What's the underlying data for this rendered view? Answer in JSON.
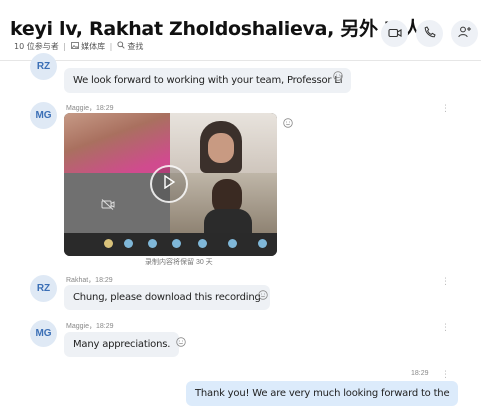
{
  "header": {
    "title": "keyi lv, Rakhat Zholdoshalieva, 另外 7 人",
    "participants": "10 位参与者",
    "gallery": "媒体库",
    "search": "查找"
  },
  "messages": [
    {
      "initials": "RZ",
      "text": "We look forward to working with your team, Professor Li"
    },
    {
      "initials": "MG",
      "sender": "Maggie，18:29",
      "recording_note": "录制内容将保留 30 天"
    },
    {
      "initials": "RZ",
      "sender": "Rakhat，18:29",
      "text": "Chung, please download this recording"
    },
    {
      "initials": "MG",
      "sender": "Maggie，18:29",
      "text": "Many appreciations."
    },
    {
      "time": "18:29",
      "text": "Thank you! We are very much looking forward to the"
    }
  ],
  "icons": {
    "video_call": "video-camera-icon",
    "audio_call": "phone-icon",
    "add_person": "add-person-icon",
    "gallery": "image-icon",
    "search": "search-icon",
    "play": "play-icon",
    "emoji": "smiley-icon",
    "more": "more-vertical-icon"
  },
  "colors": {
    "accent": "#3b6fb6",
    "bubble": "#eef1f5",
    "my_bubble": "#dcebfb"
  }
}
